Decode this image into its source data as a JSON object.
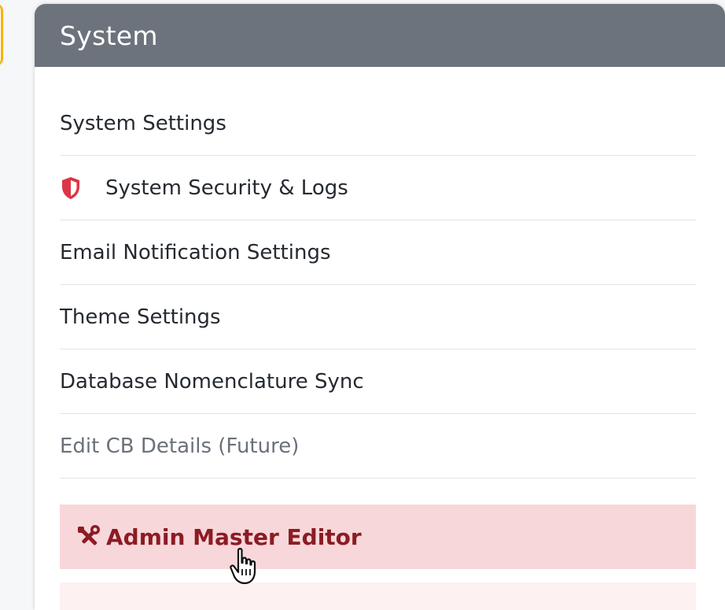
{
  "panel": {
    "title": "System"
  },
  "menu": {
    "items": [
      {
        "label": "System Settings",
        "icon": null,
        "enabled": true
      },
      {
        "label": "System Security & Logs",
        "icon": "shield-icon",
        "enabled": true
      },
      {
        "label": "Email Notification Settings",
        "icon": null,
        "enabled": true
      },
      {
        "label": "Theme Settings",
        "icon": null,
        "enabled": true
      },
      {
        "label": "Database Nomenclature Sync",
        "icon": null,
        "enabled": true
      },
      {
        "label": "Edit CB Details (Future)",
        "icon": null,
        "enabled": false
      }
    ],
    "admin": {
      "label": "Admin Master Editor",
      "icon": "tools-icon"
    }
  },
  "colors": {
    "header_bg": "#6c737c",
    "shield_red": "#dc3545",
    "admin_bg": "#f8d7da",
    "admin_text": "#8b1c24",
    "left_card_accent": "#f4b400"
  }
}
